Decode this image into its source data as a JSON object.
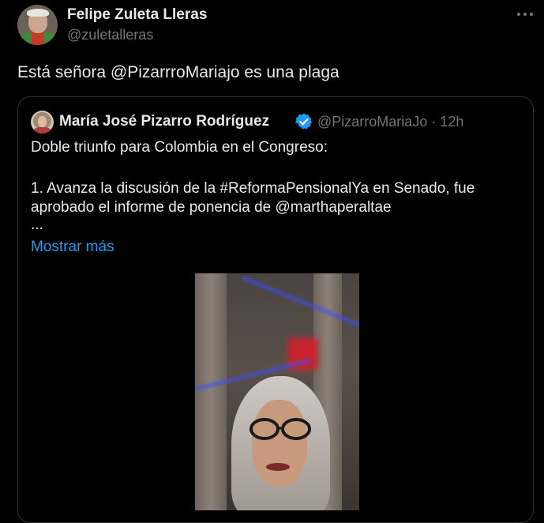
{
  "tweet": {
    "author_name": "Felipe Zuleta Lleras",
    "author_handle": "@zuletalleras",
    "more_icon": "more-horizontal-icon",
    "text": "Está señora @PizarrroMariajo es una plaga"
  },
  "quote": {
    "author_name": "María José Pizarro Rodríguez",
    "verified_icon": "verified-badge-icon",
    "verified_color": "#1d9bf0",
    "meta": "@PizarroMariaJo · 12h",
    "body": [
      "Doble triunfo para Colombia en el Congreso:",
      "1. Avanza la discusión de la #ReformaPensionalYa en Senado, fue",
      "aprobado el informe de ponencia de @marthaperaltae",
      "..."
    ],
    "show_more": "Mostrar más"
  },
  "colors": {
    "background": "#000000",
    "text_primary": "#e7e9ea",
    "text_secondary": "#71767b",
    "link": "#1d9bf0",
    "border": "#2f3336"
  }
}
